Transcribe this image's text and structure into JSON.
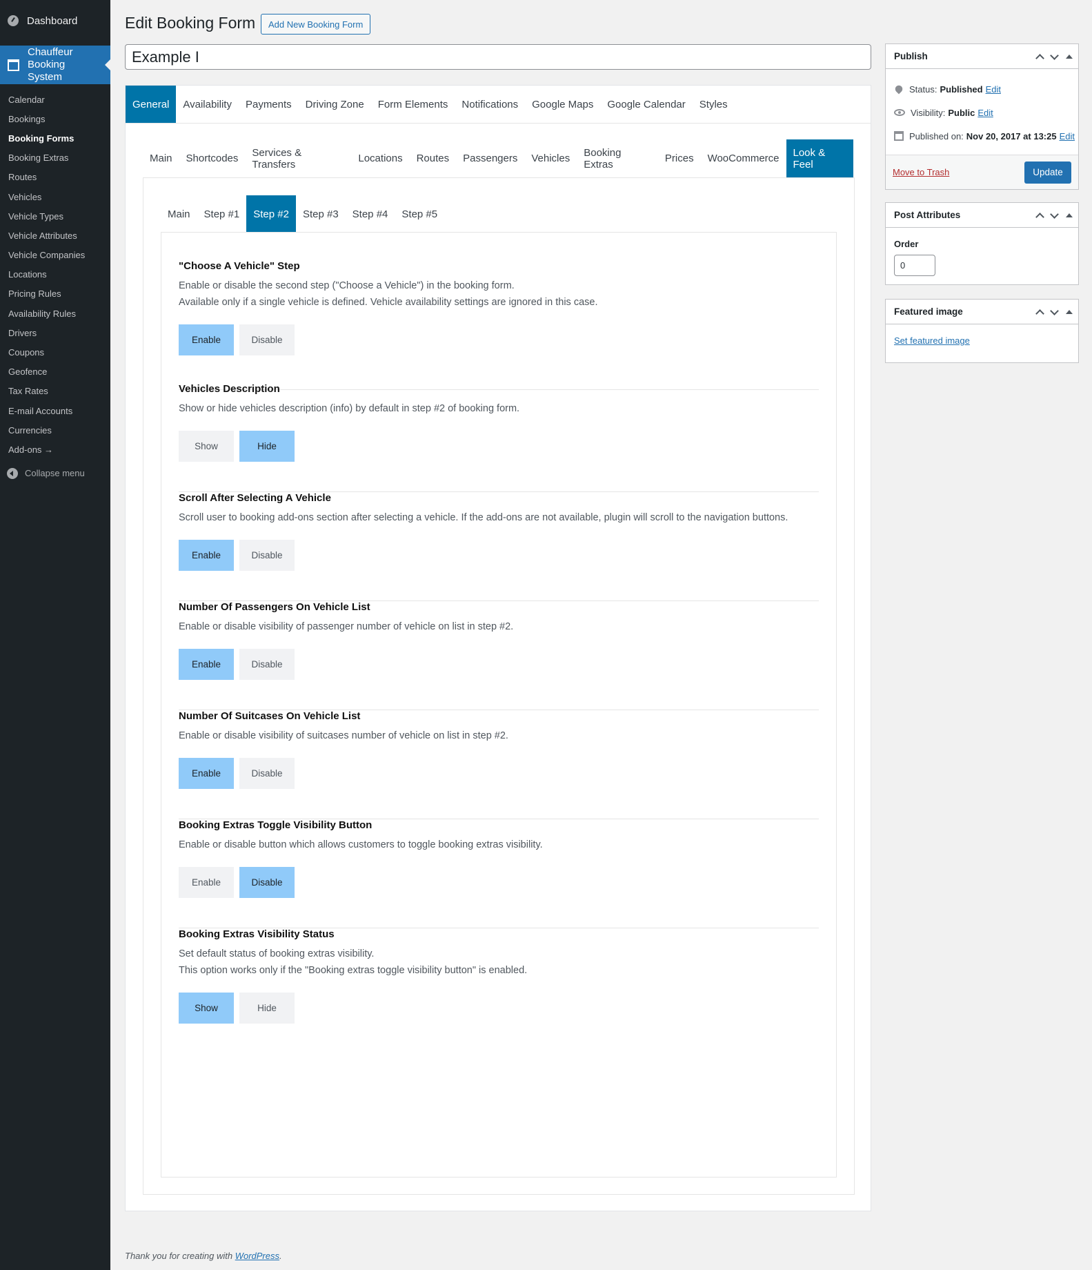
{
  "sidebar": {
    "dashboard": "Dashboard",
    "current_menu": "Chauffeur Booking System",
    "items": [
      {
        "label": "Calendar",
        "active": false
      },
      {
        "label": "Bookings",
        "active": false
      },
      {
        "label": "Booking Forms",
        "active": true
      },
      {
        "label": "Booking Extras",
        "active": false
      },
      {
        "label": "Routes",
        "active": false
      },
      {
        "label": "Vehicles",
        "active": false
      },
      {
        "label": "Vehicle Types",
        "active": false
      },
      {
        "label": "Vehicle Attributes",
        "active": false
      },
      {
        "label": "Vehicle Companies",
        "active": false
      },
      {
        "label": "Locations",
        "active": false
      },
      {
        "label": "Pricing Rules",
        "active": false
      },
      {
        "label": "Availability Rules",
        "active": false
      },
      {
        "label": "Drivers",
        "active": false
      },
      {
        "label": "Coupons",
        "active": false
      },
      {
        "label": "Geofence",
        "active": false
      },
      {
        "label": "Tax Rates",
        "active": false
      },
      {
        "label": "E-mail Accounts",
        "active": false
      },
      {
        "label": "Currencies",
        "active": false
      },
      {
        "label": "Add-ons →",
        "active": false
      }
    ],
    "collapse": "Collapse menu"
  },
  "header": {
    "title": "Edit Booking Form",
    "add_new": "Add New Booking Form",
    "post_title": "Example I"
  },
  "tabs_main": [
    "General",
    "Availability",
    "Payments",
    "Driving Zone",
    "Form Elements",
    "Notifications",
    "Google Maps",
    "Google Calendar",
    "Styles"
  ],
  "tabs_main_active": 0,
  "tabs_general": [
    "Main",
    "Shortcodes",
    "Services & Transfers",
    "Locations",
    "Routes",
    "Passengers",
    "Vehicles",
    "Booking Extras",
    "Prices",
    "WooCommerce",
    "Look & Feel"
  ],
  "tabs_general_active": 10,
  "tabs_steps": [
    "Main",
    "Step #1",
    "Step #2",
    "Step #3",
    "Step #4",
    "Step #5"
  ],
  "tabs_steps_active": 2,
  "sections": [
    {
      "title": "\"Choose A Vehicle\" Step",
      "desc": [
        "Enable or disable the second step (\"Choose a Vehicle\") in the booking form.",
        "Available only if a single vehicle is defined. Vehicle availability settings are ignored in this case."
      ],
      "options": [
        "Enable",
        "Disable"
      ],
      "selected": 0
    },
    {
      "title": "Vehicles Description",
      "desc": [
        "Show or hide vehicles description (info) by default in step #2 of booking form."
      ],
      "options": [
        "Show",
        "Hide"
      ],
      "selected": 1
    },
    {
      "title": "Scroll After Selecting A Vehicle",
      "desc": [
        "Scroll user to booking add-ons section after selecting a vehicle. If the add-ons are not available, plugin will scroll to the navigation buttons."
      ],
      "options": [
        "Enable",
        "Disable"
      ],
      "selected": 0
    },
    {
      "title": "Number Of Passengers On Vehicle List",
      "desc": [
        "Enable or disable visibility of passenger number of vehicle on list in step #2."
      ],
      "options": [
        "Enable",
        "Disable"
      ],
      "selected": 0
    },
    {
      "title": "Number Of Suitcases On Vehicle List",
      "desc": [
        "Enable or disable visibility of suitcases number of vehicle on list in step #2."
      ],
      "options": [
        "Enable",
        "Disable"
      ],
      "selected": 0
    },
    {
      "title": "Booking Extras Toggle Visibility Button",
      "desc": [
        "Enable or disable button which allows customers to toggle booking extras visibility."
      ],
      "options": [
        "Enable",
        "Disable"
      ],
      "selected": 1
    },
    {
      "title": "Booking Extras Visibility Status",
      "desc": [
        "Set default status of booking extras visibility.",
        "This option works only if the \"Booking extras toggle visibility button\" is enabled."
      ],
      "options": [
        "Show",
        "Hide"
      ],
      "selected": 0
    }
  ],
  "publish": {
    "title": "Publish",
    "status_label": "Status:",
    "status_value": "Published",
    "visibility_label": "Visibility:",
    "visibility_value": "Public",
    "published_label": "Published on:",
    "published_value": "Nov 20, 2017 at 13:25",
    "edit": "Edit",
    "trash": "Move to Trash",
    "update": "Update"
  },
  "post_attributes": {
    "title": "Post Attributes",
    "order_label": "Order",
    "order_value": "0"
  },
  "featured_image": {
    "title": "Featured image",
    "link": "Set featured image"
  },
  "footer": {
    "text": "Thank you for creating with",
    "link": "WordPress",
    "end": "."
  },
  "colors": {
    "accent": "#0074a8",
    "selected_button": "#90caf9",
    "sidebar": "#1d2327",
    "admin_blue": "#2271b1"
  }
}
